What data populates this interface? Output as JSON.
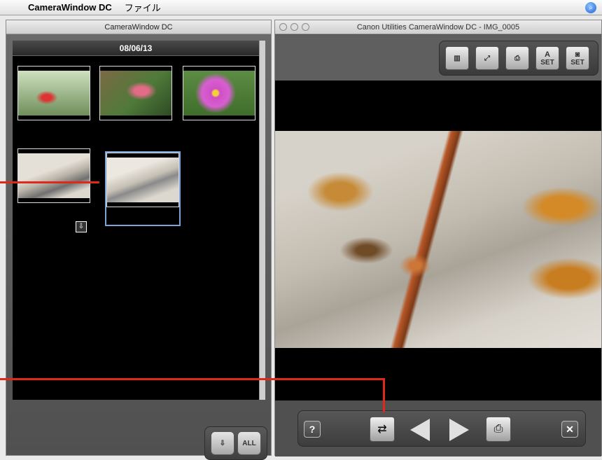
{
  "menubar": {
    "apple_icon": "apple-logo",
    "app_name": "CameraWindow DC",
    "menu_file": "ファイル",
    "spotlight_icon": "spotlight-search"
  },
  "left_window": {
    "title": "CameraWindow DC",
    "date_header": "08/06/13",
    "thumbnails": [
      {
        "name": "red-flower-bud"
      },
      {
        "name": "pink-tulip-bud"
      },
      {
        "name": "pink-cosmos-flower"
      },
      {
        "name": "dragonfly-small"
      },
      {
        "name": "dragonfly-selected"
      }
    ],
    "protect_icon": "protect-icon",
    "toolbar": {
      "import_selected_icon": "import-selected-icon",
      "import_all_label": "ALL"
    }
  },
  "right_window": {
    "title": "Canon Utilities CameraWindow DC - IMG_0005",
    "view_toolbar": {
      "set_a_label": "SET",
      "set_b_label": "SET"
    },
    "controls": {
      "help_label": "?",
      "close_label": "✕"
    }
  },
  "colors": {
    "callout_red": "#e0281b",
    "selection_blue": "#7ea3d6"
  }
}
